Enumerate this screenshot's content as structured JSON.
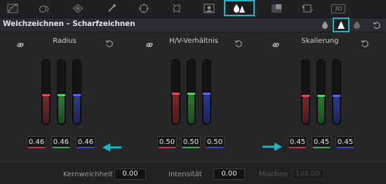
{
  "toolbar": {
    "tools": [
      {
        "icon": "curves-icon"
      },
      {
        "icon": "qualifier-icon"
      },
      {
        "icon": "power-window-icon"
      },
      {
        "icon": "tracker-icon"
      },
      {
        "icon": "magic-mask-icon"
      },
      {
        "icon": "blur-icon"
      },
      {
        "icon": "key-icon"
      },
      {
        "icon": "blur-sharpen-icon",
        "active": true
      },
      {
        "icon": "sizing-icon"
      },
      {
        "icon": "motion-effects-icon"
      },
      {
        "icon": "3d-icon",
        "label": "3D"
      }
    ]
  },
  "header": {
    "title": "Weichzeichnen – Scharfzeichnen",
    "modes": [
      "blur-mode-icon",
      "sharpen-mode-icon",
      "mist-mode-icon"
    ],
    "active_mode": "sharpen-mode-icon"
  },
  "panels": [
    {
      "title": "Radius",
      "values": {
        "r": "0.46",
        "g": "0.46",
        "b": "0.46"
      },
      "level": 0.46
    },
    {
      "title": "H/V-Verhältnis",
      "values": {
        "r": "0.50",
        "g": "0.50",
        "b": "0.50"
      },
      "level": 0.5
    },
    {
      "title": "Skalierung",
      "values": {
        "r": "0.45",
        "g": "0.45",
        "b": "0.45"
      },
      "level": 0.45
    }
  ],
  "footer": {
    "core_softness_label": "Kernweichheit",
    "core_softness_value": "0.00",
    "intensity_label": "Intensität",
    "intensity_value": "0.00",
    "mix_label": "Mischen",
    "mix_value": "100.00"
  },
  "colors": {
    "accent": "#1bb9c4",
    "red": "#c8343a",
    "green": "#3ab04a",
    "blue": "#3a48d0"
  }
}
